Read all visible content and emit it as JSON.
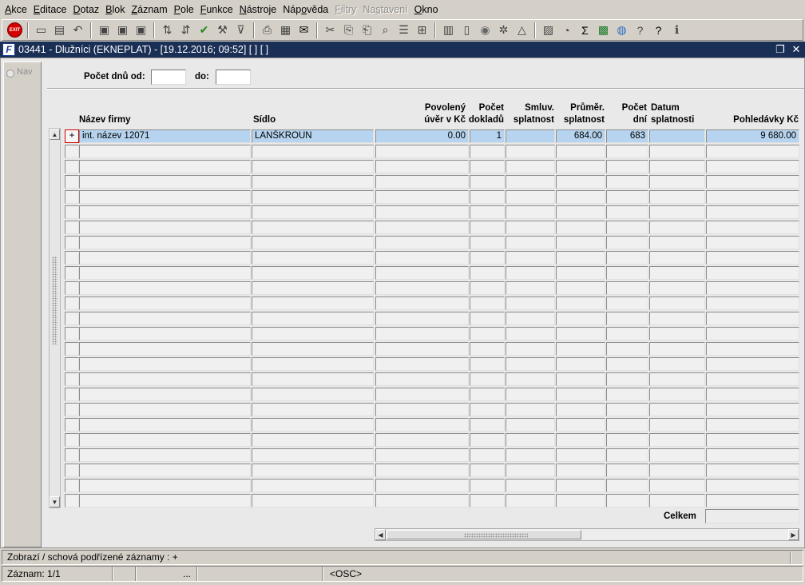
{
  "menu": [
    {
      "label": "Akce",
      "u": "A",
      "disabled": false
    },
    {
      "label": "Editace",
      "u": "E",
      "disabled": false
    },
    {
      "label": "Dotaz",
      "u": "D",
      "disabled": false
    },
    {
      "label": "Blok",
      "u": "B",
      "disabled": false
    },
    {
      "label": "Záznam",
      "u": "Z",
      "disabled": false
    },
    {
      "label": "Pole",
      "u": "P",
      "disabled": false
    },
    {
      "label": "Funkce",
      "u": "F",
      "disabled": false
    },
    {
      "label": "Nástroje",
      "u": "N",
      "disabled": false
    },
    {
      "label": "Nápověda",
      "u": "o",
      "disabled": false
    },
    {
      "label": "Filtry",
      "u": "F",
      "disabled": true
    },
    {
      "label": "Nastavení",
      "u": "s",
      "disabled": true
    },
    {
      "label": "Okno",
      "u": "O",
      "disabled": false
    }
  ],
  "toolbar": {
    "exit_label": "EXIT",
    "icons": [
      "exit-icon",
      "sep",
      "save-record-icon",
      "print-form-icon",
      "undo-icon",
      "sep",
      "folder-open-icon",
      "folder-refresh-icon",
      "folder-delete-icon",
      "sep",
      "sort-asc-icon",
      "sort-desc-icon",
      "checkmark-icon",
      "wrench-icon",
      "filter-icon",
      "sep",
      "printer-icon",
      "preview-icon",
      "email-icon",
      "sep",
      "cut-icon",
      "copy-icon",
      "paste-icon",
      "find-icon",
      "list-icon",
      "tree-icon",
      "sep",
      "clipboard-icon",
      "document-icon",
      "globe-icon",
      "gear-icon",
      "mountain-icon",
      "sep",
      "chart-icon",
      "clock-icon",
      "sum-icon",
      "excel-icon",
      "world-icon",
      "help-icon",
      "help-question-icon",
      "info-icon"
    ],
    "glyphs": {
      "save-record-icon": "▭",
      "print-form-icon": "▤",
      "undo-icon": "↶",
      "folder-open-icon": "▣",
      "folder-refresh-icon": "▣",
      "folder-delete-icon": "▣",
      "sort-asc-icon": "⇅",
      "sort-desc-icon": "⇵",
      "checkmark-icon": "✔",
      "wrench-icon": "⚒",
      "filter-icon": "⊽",
      "printer-icon": "⎙",
      "preview-icon": "▦",
      "email-icon": "✉",
      "cut-icon": "✂",
      "copy-icon": "⎘",
      "paste-icon": "⎗",
      "find-icon": "⌕",
      "list-icon": "☰",
      "tree-icon": "⊞",
      "clipboard-icon": "▥",
      "document-icon": "▯",
      "globe-icon": "◉",
      "gear-icon": "✲",
      "mountain-icon": "△",
      "chart-icon": "▨",
      "clock-icon": "◔",
      "sum-icon": "Σ",
      "excel-icon": "▩",
      "world-icon": "◍",
      "help-icon": "?",
      "help-question-icon": "?",
      "info-icon": "ℹ"
    },
    "colors": {
      "checkmark-icon": "#1d8a1d",
      "sum-icon": "#000000",
      "excel-icon": "#1c7a2a",
      "help-question-icon": "#000000",
      "world-icon": "#2d6fc4",
      "email-icon": "#000000",
      "globe-icon": "#666666"
    }
  },
  "window": {
    "app_icon": "F",
    "title": "03441 - Dlužníci (EKNEPLAT) - [19.12.2016; 09:52] [ ] [ ]",
    "restore_glyph": "❐",
    "close_glyph": "✕"
  },
  "nav": {
    "label": "Nav"
  },
  "filter": {
    "days_from_label": "Počet dnů od:",
    "days_from_value": "",
    "days_to_label": "do:",
    "days_to_value": ""
  },
  "columns": [
    {
      "key": "name",
      "line1": "",
      "line2": "Název firmy",
      "align": "left"
    },
    {
      "key": "seat",
      "line1": "",
      "line2": "Sídlo",
      "align": "left"
    },
    {
      "key": "credit",
      "line1": "Povolený",
      "line2": "úvěr v Kč",
      "align": "right"
    },
    {
      "key": "docs",
      "line1": "Počet",
      "line2": "dokladů",
      "align": "right"
    },
    {
      "key": "terms",
      "line1": "Smluv.",
      "line2": "splatnost",
      "align": "right"
    },
    {
      "key": "avg",
      "line1": "Průměr.",
      "line2": "splatnost",
      "align": "right"
    },
    {
      "key": "days",
      "line1": "Počet",
      "line2": "dní",
      "align": "right"
    },
    {
      "key": "due_date",
      "line1": "Datum",
      "line2": "splatnosti",
      "align": "left"
    },
    {
      "key": "receivables",
      "line1": "",
      "line2": "Pohledávky Kč",
      "align": "right"
    }
  ],
  "rows": [
    {
      "marker": "+",
      "name": "int. název 12071",
      "seat": "LANŠKROUN",
      "credit": "0.00",
      "docs": "1",
      "terms": "",
      "avg": "684.00",
      "days": "683",
      "due_date": "",
      "receivables": "9 680.00"
    }
  ],
  "empty_row_count": 24,
  "footer": {
    "total_label": "Celkem",
    "total_value": ""
  },
  "scroll": {
    "up_glyph": "▲",
    "down_glyph": "▼",
    "left_glyph": "◀",
    "right_glyph": "▶"
  },
  "status": {
    "hint": "Zobrazí / schová podřízené záznamy : +",
    "record": "Záznam: 1/1",
    "seg3": "...",
    "mode": "<OSC>"
  }
}
